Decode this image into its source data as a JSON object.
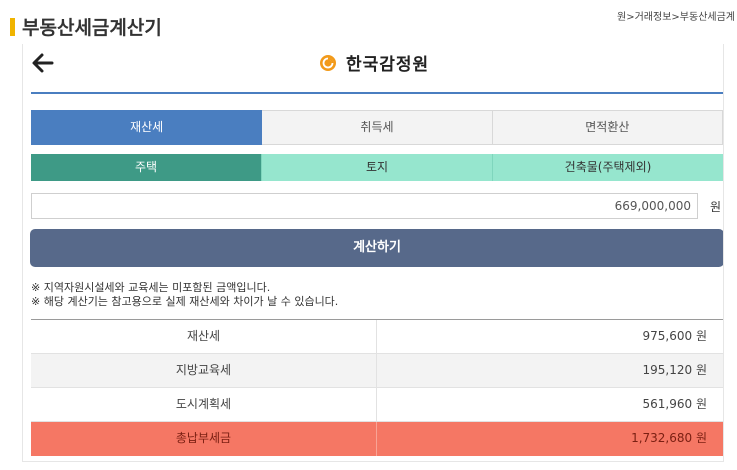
{
  "header": {
    "title": "부동산세금계산기",
    "breadcrumb": "원>거래정보>부동산세금계"
  },
  "navbar": {
    "logo_text": "한국감정원"
  },
  "tabs": [
    {
      "label": "재산세",
      "active": true
    },
    {
      "label": "취득세",
      "active": false
    },
    {
      "label": "면적환산",
      "active": false
    }
  ],
  "subtabs": [
    {
      "label": "주택",
      "active": true
    },
    {
      "label": "토지",
      "active": false
    },
    {
      "label": "건축물(주택제외)",
      "active": false
    }
  ],
  "amount": {
    "value": "669,000,000",
    "unit": "원"
  },
  "calculate_label": "계산하기",
  "notes": [
    "※ 지역자원시설세와 교육세는 미포함된 금액입니다.",
    "※ 해당 계산기는 참고용으로 실제 재산세와 차이가 날 수 있습니다."
  ],
  "results": [
    {
      "label": "재산세",
      "value": "975,600 원"
    },
    {
      "label": "지방교육세",
      "value": "195,120 원"
    },
    {
      "label": "도시계획세",
      "value": "561,960 원"
    },
    {
      "label": "총납부세금",
      "value": "1,732,680 원"
    }
  ],
  "colors": {
    "primary_blue": "#4a7ec0",
    "subtab_active": "#3e9a86",
    "subtab_inactive": "#96e6ce",
    "button": "#57698a",
    "total_row": "#f57764",
    "title_mark": "#f0b400",
    "logo_orange": "#f29a1a"
  },
  "icons": {
    "back": "back-arrow-icon",
    "logo": "kab-logo-icon"
  }
}
